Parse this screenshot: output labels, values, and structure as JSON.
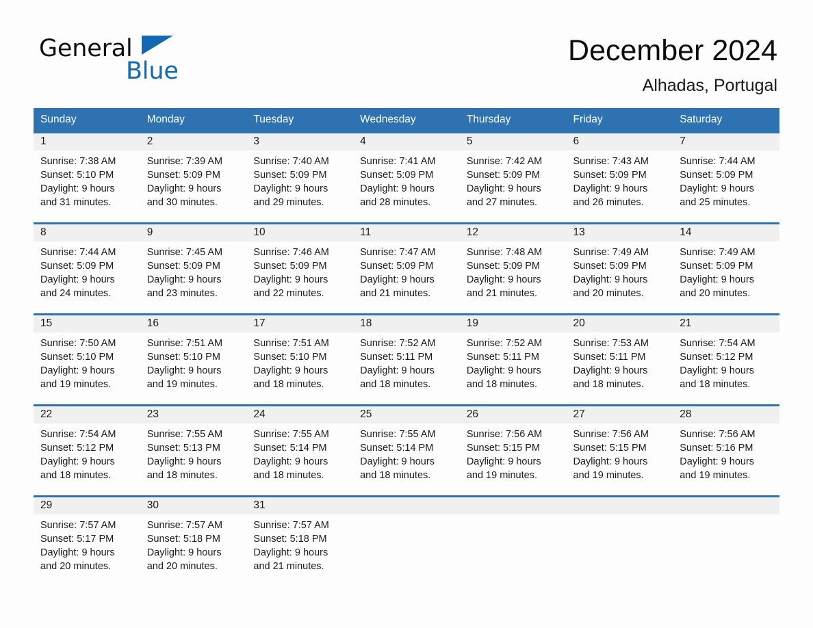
{
  "brand": {
    "word_one": "General",
    "word_two": "Blue",
    "triangle_color": "#1268B3"
  },
  "header": {
    "month_title": "December 2024",
    "location": "Alhadas, Portugal",
    "accent_color": "#2E72B2",
    "daynum_strip_color": "#F0F0F0"
  },
  "weekday_headers": [
    "Sunday",
    "Monday",
    "Tuesday",
    "Wednesday",
    "Thursday",
    "Friday",
    "Saturday"
  ],
  "weeks": [
    [
      {
        "day": "1",
        "sunrise": "Sunrise: 7:38 AM",
        "sunset": "Sunset: 5:10 PM",
        "daylight_1": "Daylight: 9 hours",
        "daylight_2": "and 31 minutes."
      },
      {
        "day": "2",
        "sunrise": "Sunrise: 7:39 AM",
        "sunset": "Sunset: 5:09 PM",
        "daylight_1": "Daylight: 9 hours",
        "daylight_2": "and 30 minutes."
      },
      {
        "day": "3",
        "sunrise": "Sunrise: 7:40 AM",
        "sunset": "Sunset: 5:09 PM",
        "daylight_1": "Daylight: 9 hours",
        "daylight_2": "and 29 minutes."
      },
      {
        "day": "4",
        "sunrise": "Sunrise: 7:41 AM",
        "sunset": "Sunset: 5:09 PM",
        "daylight_1": "Daylight: 9 hours",
        "daylight_2": "and 28 minutes."
      },
      {
        "day": "5",
        "sunrise": "Sunrise: 7:42 AM",
        "sunset": "Sunset: 5:09 PM",
        "daylight_1": "Daylight: 9 hours",
        "daylight_2": "and 27 minutes."
      },
      {
        "day": "6",
        "sunrise": "Sunrise: 7:43 AM",
        "sunset": "Sunset: 5:09 PM",
        "daylight_1": "Daylight: 9 hours",
        "daylight_2": "and 26 minutes."
      },
      {
        "day": "7",
        "sunrise": "Sunrise: 7:44 AM",
        "sunset": "Sunset: 5:09 PM",
        "daylight_1": "Daylight: 9 hours",
        "daylight_2": "and 25 minutes."
      }
    ],
    [
      {
        "day": "8",
        "sunrise": "Sunrise: 7:44 AM",
        "sunset": "Sunset: 5:09 PM",
        "daylight_1": "Daylight: 9 hours",
        "daylight_2": "and 24 minutes."
      },
      {
        "day": "9",
        "sunrise": "Sunrise: 7:45 AM",
        "sunset": "Sunset: 5:09 PM",
        "daylight_1": "Daylight: 9 hours",
        "daylight_2": "and 23 minutes."
      },
      {
        "day": "10",
        "sunrise": "Sunrise: 7:46 AM",
        "sunset": "Sunset: 5:09 PM",
        "daylight_1": "Daylight: 9 hours",
        "daylight_2": "and 22 minutes."
      },
      {
        "day": "11",
        "sunrise": "Sunrise: 7:47 AM",
        "sunset": "Sunset: 5:09 PM",
        "daylight_1": "Daylight: 9 hours",
        "daylight_2": "and 21 minutes."
      },
      {
        "day": "12",
        "sunrise": "Sunrise: 7:48 AM",
        "sunset": "Sunset: 5:09 PM",
        "daylight_1": "Daylight: 9 hours",
        "daylight_2": "and 21 minutes."
      },
      {
        "day": "13",
        "sunrise": "Sunrise: 7:49 AM",
        "sunset": "Sunset: 5:09 PM",
        "daylight_1": "Daylight: 9 hours",
        "daylight_2": "and 20 minutes."
      },
      {
        "day": "14",
        "sunrise": "Sunrise: 7:49 AM",
        "sunset": "Sunset: 5:09 PM",
        "daylight_1": "Daylight: 9 hours",
        "daylight_2": "and 20 minutes."
      }
    ],
    [
      {
        "day": "15",
        "sunrise": "Sunrise: 7:50 AM",
        "sunset": "Sunset: 5:10 PM",
        "daylight_1": "Daylight: 9 hours",
        "daylight_2": "and 19 minutes."
      },
      {
        "day": "16",
        "sunrise": "Sunrise: 7:51 AM",
        "sunset": "Sunset: 5:10 PM",
        "daylight_1": "Daylight: 9 hours",
        "daylight_2": "and 19 minutes."
      },
      {
        "day": "17",
        "sunrise": "Sunrise: 7:51 AM",
        "sunset": "Sunset: 5:10 PM",
        "daylight_1": "Daylight: 9 hours",
        "daylight_2": "and 18 minutes."
      },
      {
        "day": "18",
        "sunrise": "Sunrise: 7:52 AM",
        "sunset": "Sunset: 5:11 PM",
        "daylight_1": "Daylight: 9 hours",
        "daylight_2": "and 18 minutes."
      },
      {
        "day": "19",
        "sunrise": "Sunrise: 7:52 AM",
        "sunset": "Sunset: 5:11 PM",
        "daylight_1": "Daylight: 9 hours",
        "daylight_2": "and 18 minutes."
      },
      {
        "day": "20",
        "sunrise": "Sunrise: 7:53 AM",
        "sunset": "Sunset: 5:11 PM",
        "daylight_1": "Daylight: 9 hours",
        "daylight_2": "and 18 minutes."
      },
      {
        "day": "21",
        "sunrise": "Sunrise: 7:54 AM",
        "sunset": "Sunset: 5:12 PM",
        "daylight_1": "Daylight: 9 hours",
        "daylight_2": "and 18 minutes."
      }
    ],
    [
      {
        "day": "22",
        "sunrise": "Sunrise: 7:54 AM",
        "sunset": "Sunset: 5:12 PM",
        "daylight_1": "Daylight: 9 hours",
        "daylight_2": "and 18 minutes."
      },
      {
        "day": "23",
        "sunrise": "Sunrise: 7:55 AM",
        "sunset": "Sunset: 5:13 PM",
        "daylight_1": "Daylight: 9 hours",
        "daylight_2": "and 18 minutes."
      },
      {
        "day": "24",
        "sunrise": "Sunrise: 7:55 AM",
        "sunset": "Sunset: 5:14 PM",
        "daylight_1": "Daylight: 9 hours",
        "daylight_2": "and 18 minutes."
      },
      {
        "day": "25",
        "sunrise": "Sunrise: 7:55 AM",
        "sunset": "Sunset: 5:14 PM",
        "daylight_1": "Daylight: 9 hours",
        "daylight_2": "and 18 minutes."
      },
      {
        "day": "26",
        "sunrise": "Sunrise: 7:56 AM",
        "sunset": "Sunset: 5:15 PM",
        "daylight_1": "Daylight: 9 hours",
        "daylight_2": "and 19 minutes."
      },
      {
        "day": "27",
        "sunrise": "Sunrise: 7:56 AM",
        "sunset": "Sunset: 5:15 PM",
        "daylight_1": "Daylight: 9 hours",
        "daylight_2": "and 19 minutes."
      },
      {
        "day": "28",
        "sunrise": "Sunrise: 7:56 AM",
        "sunset": "Sunset: 5:16 PM",
        "daylight_1": "Daylight: 9 hours",
        "daylight_2": "and 19 minutes."
      }
    ],
    [
      {
        "day": "29",
        "sunrise": "Sunrise: 7:57 AM",
        "sunset": "Sunset: 5:17 PM",
        "daylight_1": "Daylight: 9 hours",
        "daylight_2": "and 20 minutes."
      },
      {
        "day": "30",
        "sunrise": "Sunrise: 7:57 AM",
        "sunset": "Sunset: 5:18 PM",
        "daylight_1": "Daylight: 9 hours",
        "daylight_2": "and 20 minutes."
      },
      {
        "day": "31",
        "sunrise": "Sunrise: 7:57 AM",
        "sunset": "Sunset: 5:18 PM",
        "daylight_1": "Daylight: 9 hours",
        "daylight_2": "and 21 minutes."
      },
      {
        "day": "",
        "sunrise": "",
        "sunset": "",
        "daylight_1": "",
        "daylight_2": ""
      },
      {
        "day": "",
        "sunrise": "",
        "sunset": "",
        "daylight_1": "",
        "daylight_2": ""
      },
      {
        "day": "",
        "sunrise": "",
        "sunset": "",
        "daylight_1": "",
        "daylight_2": ""
      },
      {
        "day": "",
        "sunrise": "",
        "sunset": "",
        "daylight_1": "",
        "daylight_2": ""
      }
    ]
  ]
}
